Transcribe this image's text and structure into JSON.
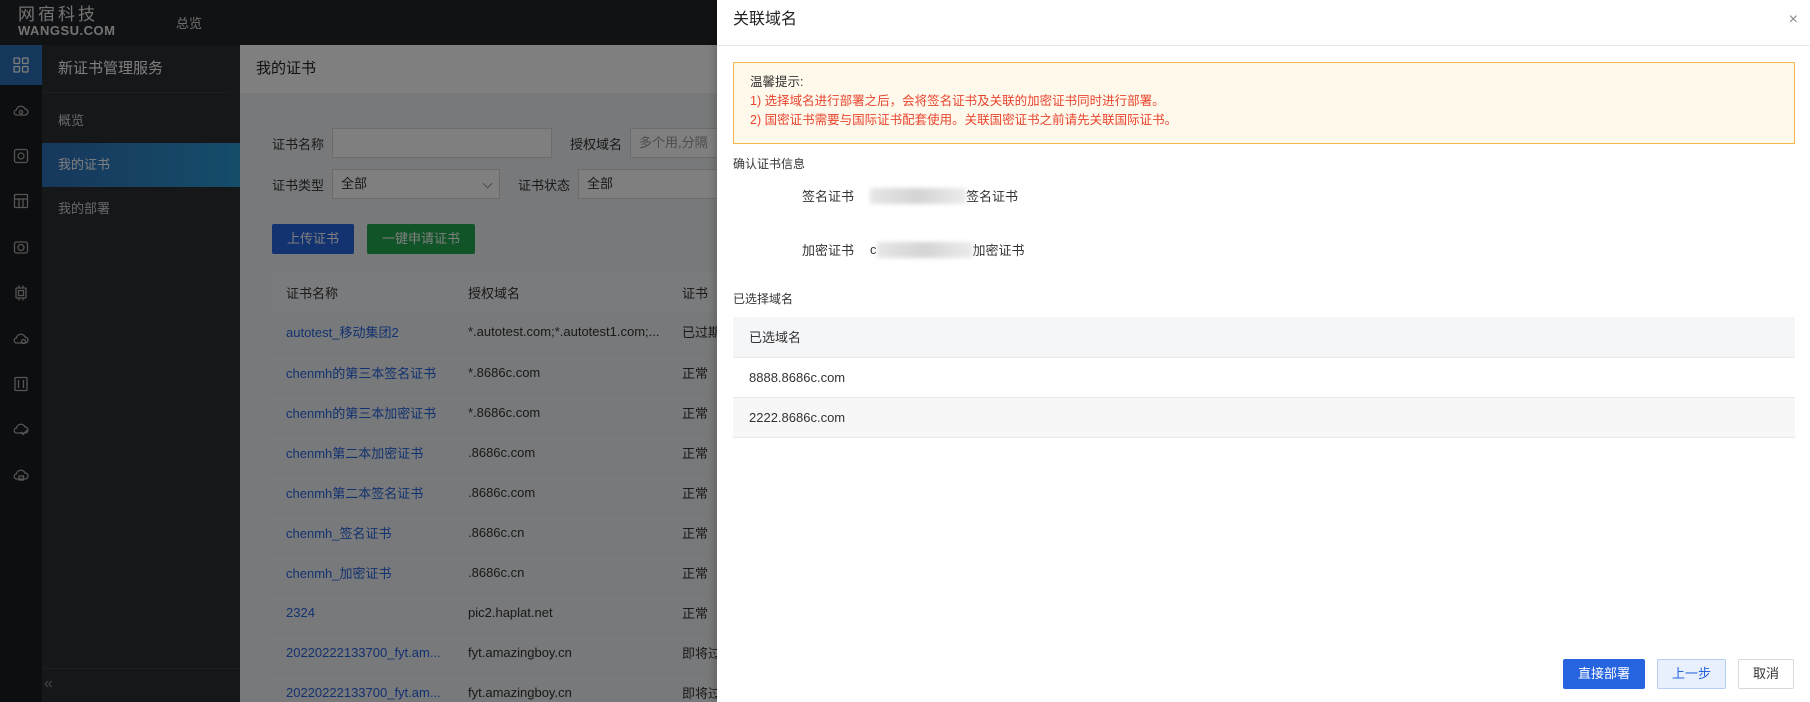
{
  "topbar": {
    "logo_cn": "网宿科技",
    "logo_en": "WANGSU.COM",
    "nav_overview": "总览"
  },
  "rail": {
    "icons": [
      "grid-icon",
      "cloud-icon",
      "shield-icon",
      "store-icon",
      "camera-icon",
      "chip-icon",
      "cloud-settings-icon",
      "building-icon",
      "cloud-check-icon",
      "cloud-lock-icon"
    ]
  },
  "submenu": {
    "title": "新证书管理服务",
    "items": [
      "概览",
      "我的证书",
      "我的部署"
    ],
    "collapse_icon": "«"
  },
  "main": {
    "header": "我的证书",
    "filters": {
      "cert_name_label": "证书名称",
      "cert_name_value": "",
      "domain_label": "授权域名",
      "domain_placeholder": "多个用,分隔",
      "cert_type_label": "证书类型",
      "cert_type_value": "全部",
      "cert_status_label": "证书状态",
      "cert_status_value": "全部"
    },
    "buttons": {
      "upload": "上传证书",
      "apply": "一键申请证书"
    },
    "table": {
      "columns": [
        "证书名称",
        "授权域名",
        "证书"
      ],
      "rows": [
        {
          "name": "autotest_移动集团2",
          "domain": "*.autotest.com;*.autotest1.com;...",
          "status": "已过期",
          "status_type": "expired"
        },
        {
          "name": "chenmh的第三本签名证书",
          "domain": "*.8686c.com",
          "status": "正常",
          "status_type": "ok"
        },
        {
          "name": "chenmh的第三本加密证书",
          "domain": "*.8686c.com",
          "status": "正常",
          "status_type": "ok"
        },
        {
          "name": "chenmh第二本加密证书",
          "domain": ".8686c.com",
          "status": "正常",
          "status_type": "ok"
        },
        {
          "name": "chenmh第二本签名证书",
          "domain": ".8686c.com",
          "status": "正常",
          "status_type": "ok"
        },
        {
          "name": "chenmh_签名证书",
          "domain": ".8686c.cn",
          "status": "正常",
          "status_type": "ok"
        },
        {
          "name": "chenmh_加密证书",
          "domain": ".8686c.cn",
          "status": "正常",
          "status_type": "ok"
        },
        {
          "name": "2324",
          "domain": "pic2.haplat.net",
          "status": "正常",
          "status_type": "ok"
        },
        {
          "name": "20220222133700_fyt.am...",
          "domain": "fyt.amazingboy.cn",
          "status": "即将过期",
          "status_type": "warn"
        },
        {
          "name": "20220222133700_fyt.am...",
          "domain": "fyt.amazingboy.cn",
          "status": "即将过期",
          "status_type": "warn"
        }
      ]
    }
  },
  "drawer": {
    "title": "关联域名",
    "close_icon": "×",
    "tip": {
      "title": "温馨提示:",
      "line1": "1) 选择域名进行部署之后，会将签名证书及关联的加密证书同时进行部署。",
      "line2": "2) 国密证书需要与国际证书配套使用。关联国密证书之前请先关联国际证书。"
    },
    "confirm_label": "确认证书信息",
    "sign_cert": {
      "label": "签名证书",
      "value_suffix": "签名证书"
    },
    "enc_cert": {
      "label": "加密证书",
      "value_prefix": "c",
      "value_suffix": "加密证书"
    },
    "selected_label": "已选择域名",
    "domain_table": {
      "header": "已选域名",
      "rows": [
        "8888.8686c.com",
        "2222.8686c.com"
      ]
    },
    "buttons": {
      "deploy": "直接部署",
      "prev": "上一步",
      "cancel": "取消"
    }
  }
}
